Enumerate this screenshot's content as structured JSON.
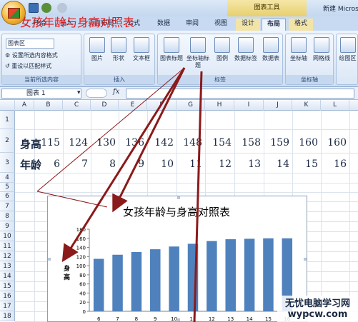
{
  "window": {
    "title": "新建 Micros",
    "context_tab_group": "图表工具"
  },
  "tabs": [
    {
      "label": "开始"
    },
    {
      "label": "插入"
    },
    {
      "label": "页面布局"
    },
    {
      "label": "公式"
    },
    {
      "label": "数据"
    },
    {
      "label": "审阅"
    },
    {
      "label": "视图"
    },
    {
      "label": "设计"
    },
    {
      "label": "布局"
    },
    {
      "label": "格式"
    }
  ],
  "ribbon": {
    "current_selection": {
      "selected": "图表区",
      "format_selection": "设置所选内容格式",
      "reset_style": "重设以匹配样式",
      "group_label": "当前所选内容"
    },
    "insert": {
      "picture": "图片",
      "shapes": "形状",
      "textbox": "文本框",
      "group_label": "插入"
    },
    "labels": {
      "chart_title": "图表标题",
      "axis_titles": "坐标轴标题",
      "legend": "图例",
      "data_labels": "数据标签",
      "data_table": "数据表",
      "group_label": "标签"
    },
    "axes": {
      "axes": "坐标轴",
      "gridlines": "网格线",
      "group_label": "坐标轴"
    },
    "background": {
      "plot_area": "绘图区"
    }
  },
  "formula_bar": {
    "name_box": "图表 1",
    "fx": "fx",
    "formula": ""
  },
  "sheet": {
    "columns": [
      "A",
      "B",
      "C",
      "D",
      "E",
      "F",
      "G",
      "H",
      "I",
      "J",
      "K",
      "L"
    ],
    "rows": [
      "1",
      "2",
      "3",
      "4",
      "5",
      "6",
      "7",
      "8",
      "9",
      "10",
      "11",
      "12",
      "13",
      "14",
      "15",
      "16",
      "17",
      "18"
    ],
    "title_cell": "女孩年龄与身高对照表",
    "height_label": "身高",
    "age_label": "年龄",
    "heights": [
      "115",
      "124",
      "130",
      "136",
      "142",
      "148",
      "154",
      "158",
      "159",
      "160",
      "160"
    ],
    "ages": [
      "6",
      "7",
      "8",
      "9",
      "10",
      "11",
      "12",
      "13",
      "14",
      "15",
      "16"
    ]
  },
  "chart_data": {
    "type": "bar",
    "title": "女孩年龄与身高对照表",
    "ylabel": "身高",
    "xlabel": "",
    "categories": [
      "6",
      "7",
      "8",
      "9",
      "10",
      "11",
      "12",
      "13",
      "14",
      "15",
      "16"
    ],
    "values": [
      115,
      124,
      130,
      136,
      142,
      148,
      154,
      158,
      159,
      160,
      160
    ],
    "ylim": [
      0,
      180
    ],
    "yticks": [
      "0",
      "20",
      "40",
      "60",
      "80",
      "100",
      "120",
      "140",
      "160",
      "180"
    ],
    "grid": false,
    "bar_color": "#4f81bd"
  },
  "watermark": {
    "line1": "无忧电脑学习网",
    "line2": "wypcw.com"
  },
  "colors": {
    "title_red": "#e01818",
    "arrow": "#8b1a1a"
  }
}
